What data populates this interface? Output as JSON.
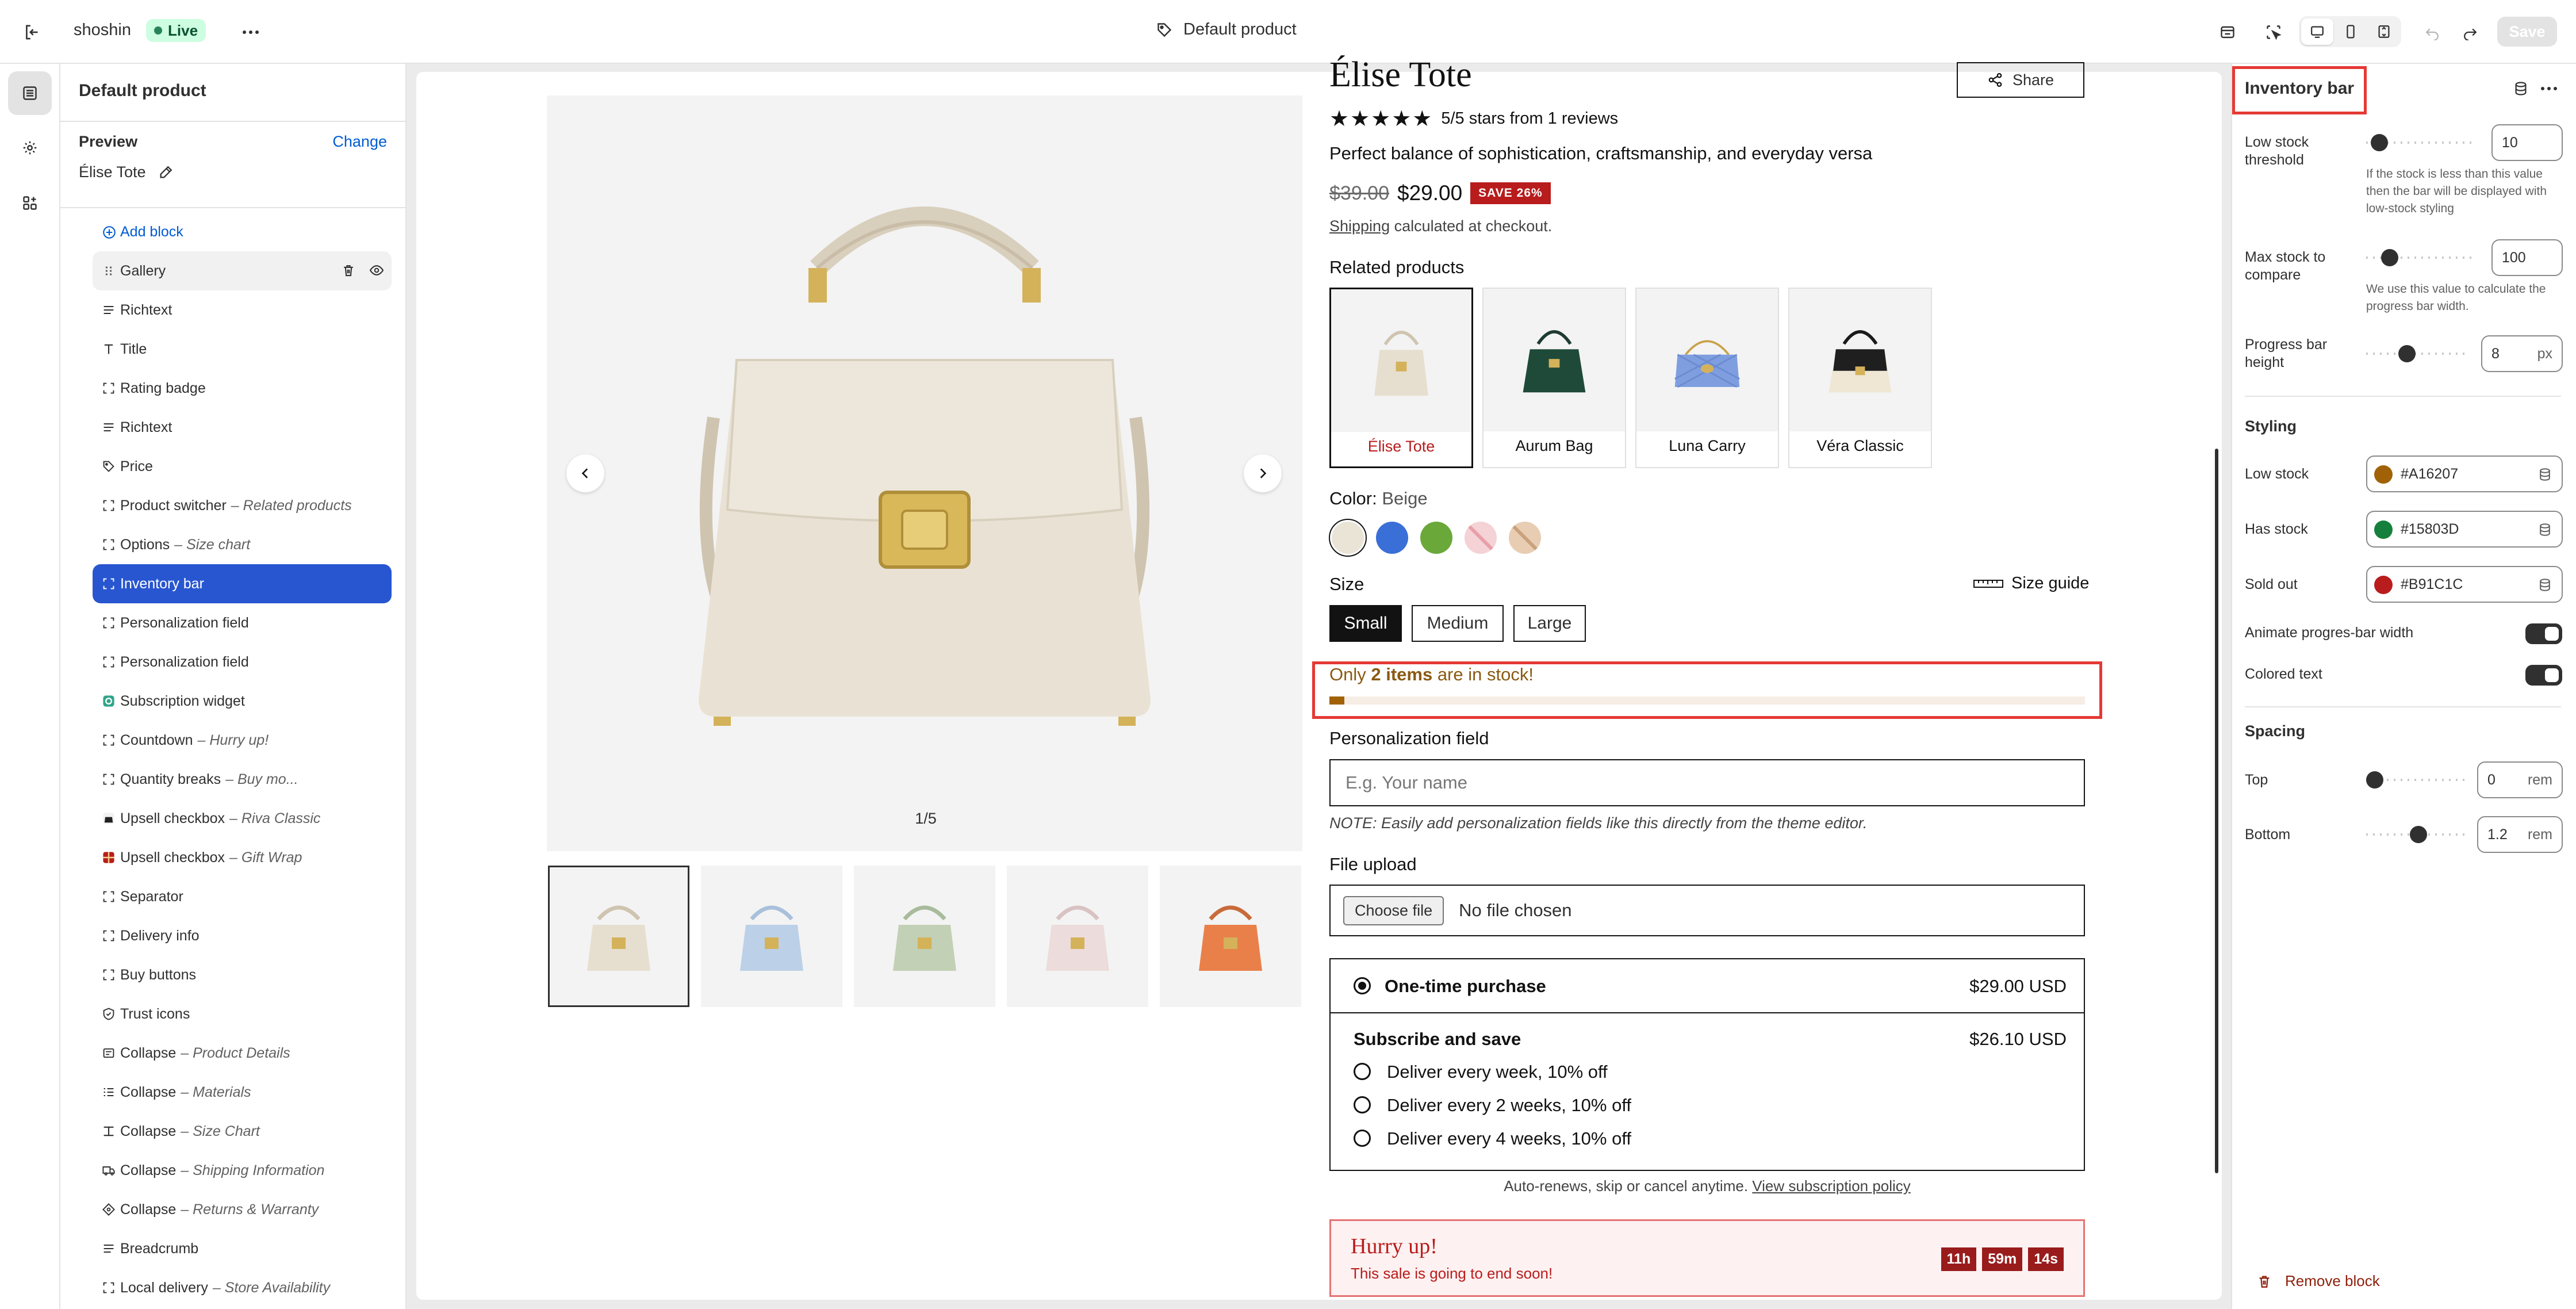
{
  "topbar": {
    "store_name": "shoshin",
    "live_label": "Live",
    "page_title": "Default product",
    "save_label": "Save"
  },
  "sidebar": {
    "title": "Default product",
    "preview_label": "Preview",
    "change_label": "Change",
    "preview_value": "Élise Tote",
    "items": [
      {
        "label": "Add block",
        "sub": "",
        "icon": "plus-circle-icon"
      },
      {
        "label": "Gallery",
        "sub": "",
        "icon": "drag-handle-icon"
      },
      {
        "label": "Richtext",
        "sub": "",
        "icon": "text-lines-icon"
      },
      {
        "label": "Title",
        "sub": "",
        "icon": "title-icon"
      },
      {
        "label": "Rating badge",
        "sub": "",
        "icon": "block-icon"
      },
      {
        "label": "Richtext",
        "sub": "",
        "icon": "text-lines-icon"
      },
      {
        "label": "Price",
        "sub": "",
        "icon": "price-tag-icon"
      },
      {
        "label": "Product switcher",
        "sub": "– Related products",
        "icon": "block-icon"
      },
      {
        "label": "Options",
        "sub": "– Size chart",
        "icon": "block-icon"
      },
      {
        "label": "Inventory bar",
        "sub": "",
        "icon": "block-icon"
      },
      {
        "label": "Personalization field",
        "sub": "",
        "icon": "block-icon"
      },
      {
        "label": "Personalization field",
        "sub": "",
        "icon": "block-icon"
      },
      {
        "label": "Subscription widget",
        "sub": "",
        "icon": "app-icon"
      },
      {
        "label": "Countdown",
        "sub": "– Hurry up!",
        "icon": "block-icon"
      },
      {
        "label": "Quantity breaks",
        "sub": "– Buy mo...",
        "icon": "block-icon"
      },
      {
        "label": "Upsell checkbox",
        "sub": "– Riva Classic",
        "icon": "product-thumb-icon"
      },
      {
        "label": "Upsell checkbox",
        "sub": "– Gift Wrap",
        "icon": "gift-thumb-icon"
      },
      {
        "label": "Separator",
        "sub": "",
        "icon": "block-icon"
      },
      {
        "label": "Delivery info",
        "sub": "",
        "icon": "block-icon"
      },
      {
        "label": "Buy buttons",
        "sub": "",
        "icon": "block-icon"
      },
      {
        "label": "Trust icons",
        "sub": "",
        "icon": "shield-icon"
      },
      {
        "label": "Collapse",
        "sub": "– Product Details",
        "icon": "collapse-icon"
      },
      {
        "label": "Collapse",
        "sub": "– Materials",
        "icon": "list-icon"
      },
      {
        "label": "Collapse",
        "sub": "– Size Chart",
        "icon": "columns-icon"
      },
      {
        "label": "Collapse",
        "sub": "– Shipping Information",
        "icon": "truck-icon"
      },
      {
        "label": "Collapse",
        "sub": "– Returns & Warranty",
        "icon": "return-icon"
      },
      {
        "label": "Breadcrumb",
        "sub": "",
        "icon": "text-lines-icon"
      },
      {
        "label": "Local delivery",
        "sub": "– Store Availability",
        "icon": "block-icon"
      }
    ]
  },
  "product": {
    "title": "Élise Tote",
    "share_label": "Share",
    "stars": "★★★★★",
    "rating_text": "5/5 stars from 1 reviews",
    "tagline": "Perfect balance of sophistication, craftsmanship, and everyday versa",
    "price_old": "$39.00",
    "price_new": "$29.00",
    "save_badge": "SAVE 26%",
    "shipping_link": "Shipping",
    "shipping_rest": " calculated at checkout.",
    "gallery_counter": "1/5",
    "related_title": "Related products",
    "related": [
      "Élise Tote",
      "Aurum Bag",
      "Luna Carry",
      "Véra Classic"
    ],
    "color_label": "Color:",
    "color_value": "Beige",
    "swatch_colors": [
      "#e9e4d6",
      "#3a6fd8",
      "#6aa83a",
      "#f4d2d6",
      "#e8cdb3"
    ],
    "size_label": "Size",
    "size_guide": "Size guide",
    "sizes": [
      "Small",
      "Medium",
      "Large"
    ],
    "inventory_prefix": "Only ",
    "inventory_bold": "2 items",
    "inventory_suffix": " are in stock!",
    "inventory_fraction": 0.02,
    "personalization_label": "Personalization field",
    "personalization_placeholder": "E.g. Your name",
    "personalization_note": "NOTE: Easily add personalization fields like this directly from the theme editor.",
    "file_upload_label": "File upload",
    "choose_file": "Choose file",
    "no_file": "No file chosen",
    "onetime_label": "One-time purchase",
    "onetime_price": "$29.00 USD",
    "subscribe_label": "Subscribe and save",
    "subscribe_price": "$26.10 USD",
    "sub_options": [
      "Deliver every week, 10% off",
      "Deliver every 2 weeks, 10% off",
      "Deliver every 4 weeks, 10% off"
    ],
    "sub_footer_text": "Auto-renews, skip or cancel anytime. ",
    "sub_footer_link": "View subscription policy",
    "hurry_title": "Hurry up!",
    "hurry_sub": "This sale is going to end soon!",
    "countdown": [
      "11h",
      "59m",
      "14s"
    ]
  },
  "panel": {
    "title": "Inventory bar",
    "low_stock_label": "Low stock threshold",
    "low_stock_value": "10",
    "low_stock_help": "If the stock is less than this value then the bar will be displayed with low-stock styling",
    "max_stock_label": "Max stock to compare",
    "max_stock_value": "100",
    "max_stock_help": "We use this value to calculate the progress bar width.",
    "bar_height_label": "Progress bar height",
    "bar_height_value": "8",
    "bar_height_unit": "px",
    "styling_title": "Styling",
    "low_stock_color_label": "Low stock",
    "low_stock_color": "#A16207",
    "has_stock_label": "Has stock",
    "has_stock_color": "#15803D",
    "sold_out_label": "Sold out",
    "sold_out_color": "#B91C1C",
    "animate_label": "Animate progres-bar width",
    "colored_text_label": "Colored text",
    "spacing_title": "Spacing",
    "top_label": "Top",
    "top_value": "0",
    "top_unit": "rem",
    "bottom_label": "Bottom",
    "bottom_value": "1.2",
    "bottom_unit": "rem",
    "remove_label": "Remove block"
  }
}
